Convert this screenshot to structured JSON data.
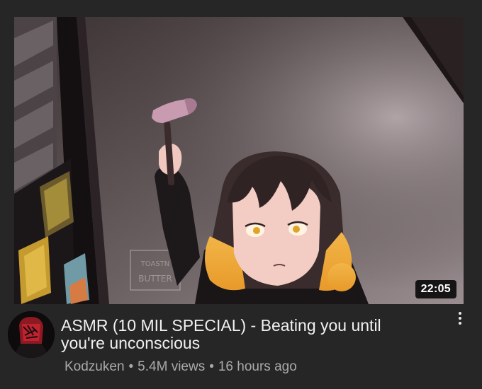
{
  "video": {
    "title": "ASMR (10 MIL SPECIAL) - Beating you until you're unconscious",
    "duration": "22:05",
    "channel": "Kodzuken",
    "views": "5.4M views",
    "age": "16 hours ago",
    "separator": "•",
    "watermark": "TOASTN BUTTER"
  },
  "icons": {
    "more": "more-vert-icon"
  }
}
